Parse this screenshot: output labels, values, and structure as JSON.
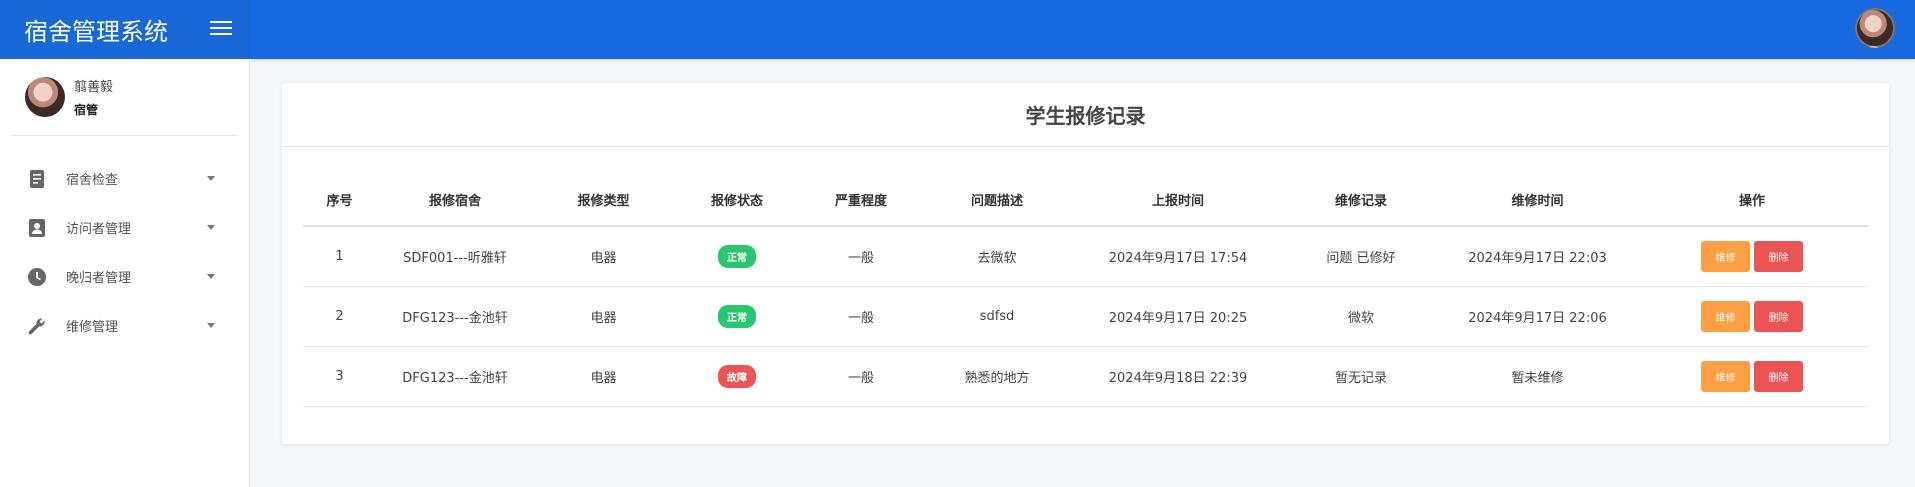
{
  "app": {
    "title": "宿舍管理系统"
  },
  "header": {
    "menu_icon": "hamburger-icon",
    "avatar": "user-avatar"
  },
  "user": {
    "name": "翦善毅",
    "role": "宿管"
  },
  "sidebar": {
    "items": [
      {
        "label": "宿舍检查",
        "icon": "book-icon"
      },
      {
        "label": "访问者管理",
        "icon": "contact-card-icon"
      },
      {
        "label": "晚归者管理",
        "icon": "clock-icon"
      },
      {
        "label": "维修管理",
        "icon": "wrench-icon"
      }
    ]
  },
  "main": {
    "title": "学生报修记录",
    "table": {
      "headers": [
        "序号",
        "报修宿舍",
        "报修类型",
        "报修状态",
        "严重程度",
        "问题描述",
        "上报时间",
        "维修记录",
        "维修时间",
        "操作"
      ],
      "rows": [
        {
          "id": "1",
          "room": "SDF001---听雅轩",
          "type": "电器",
          "status": "正常",
          "status_color": "#28c76f",
          "severity": "一般",
          "description": "去微软",
          "report_time": "2024年9月17日 17:54",
          "repair_record": "问题 已修好",
          "repair_time": "2024年9月17日 22:03"
        },
        {
          "id": "2",
          "room": "DFG123---金池轩",
          "type": "电器",
          "status": "正常",
          "status_color": "#28c76f",
          "severity": "一般",
          "description": "sdfsd",
          "report_time": "2024年9月17日 20:25",
          "repair_record": "微软",
          "repair_time": "2024年9月17日 22:06"
        },
        {
          "id": "3",
          "room": "DFG123---金池轩",
          "type": "电器",
          "status": "故障",
          "status_color": "#ea5455",
          "severity": "一般",
          "description": "熟悉的地方",
          "report_time": "2024年9月18日 22:39",
          "repair_record": "暂无记录",
          "repair_time": "暂未维修"
        }
      ],
      "actions": {
        "repair_label": "维修",
        "repair_color": "#ff9f43",
        "delete_label": "删除",
        "delete_color": "#ea5455"
      }
    }
  },
  "colors": {
    "primary": "#1769e0",
    "brand_bg": "#1868d8"
  }
}
